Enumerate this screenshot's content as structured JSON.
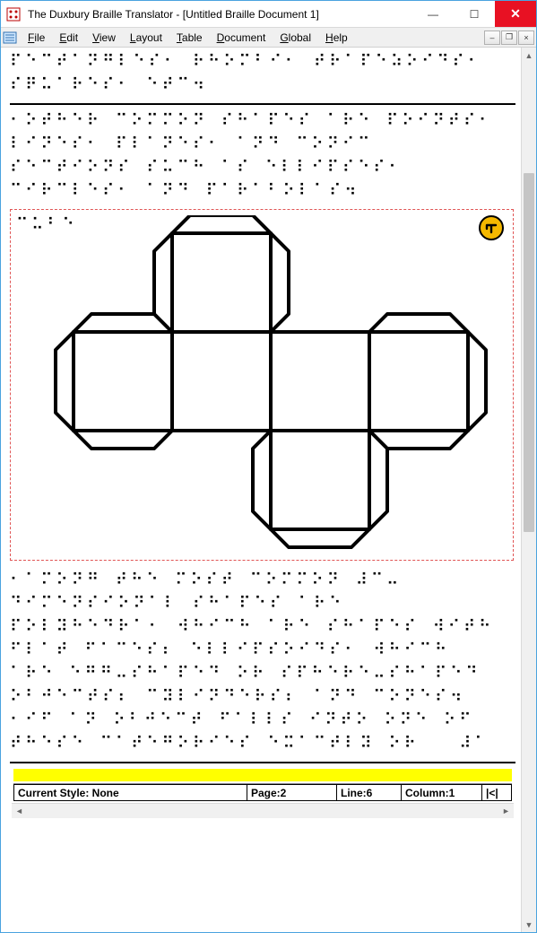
{
  "titlebar": {
    "title": "The Duxbury Braille Translator - [Untitled Braille Document 1]"
  },
  "menubar": {
    "items": [
      {
        "label": "File",
        "underline": "F"
      },
      {
        "label": "Edit",
        "underline": "E"
      },
      {
        "label": "View",
        "underline": "V"
      },
      {
        "label": "Layout",
        "underline": "L"
      },
      {
        "label": "Table",
        "underline": "T"
      },
      {
        "label": "Document",
        "underline": "D"
      },
      {
        "label": "Global",
        "underline": "G"
      },
      {
        "label": "Help",
        "underline": "H"
      }
    ]
  },
  "doc": {
    "braille1": "⠏⠑⠉⠞⠁⠝⠛⠇⠑⠎⠂ ⠗⠓⠕⠍⠃⠊⠂ ⠞⠗⠁⠏⠑⠵⠕⠊⠙⠎⠂\n⠎⠟⠥⠁⠗⠑⠎⠂ ⠑⠞⠉⠲",
    "braille2": "⠂⠕⠞⠓⠑⠗ ⠉⠕⠍⠍⠕⠝ ⠎⠓⠁⠏⠑⠎ ⠁⠗⠑ ⠏⠕⠊⠝⠞⠎⠂\n⠇⠊⠝⠑⠎⠂ ⠏⠇⠁⠝⠑⠎⠂ ⠁⠝⠙ ⠉⠕⠝⠊⠉\n⠎⠑⠉⠞⠊⠕⠝⠎ ⠎⠥⠉⠓ ⠁⠎ ⠑⠇⠇⠊⠏⠎⠑⠎⠂\n⠉⠊⠗⠉⠇⠑⠎⠂ ⠁⠝⠙ ⠏⠁⠗⠁⠃⠕⠇⠁⠎⠲",
    "embed_label": "⠉⠥⠃⠑",
    "braille3": "⠂⠁⠍⠕⠝⠛ ⠞⠓⠑ ⠍⠕⠎⠞ ⠉⠕⠍⠍⠕⠝ ⠼⠉⠤\n⠙⠊⠍⠑⠝⠎⠊⠕⠝⠁⠇ ⠎⠓⠁⠏⠑⠎ ⠁⠗⠑\n⠏⠕⠇⠽⠓⠑⠙⠗⠁⠂ ⠺⠓⠊⠉⠓ ⠁⠗⠑ ⠎⠓⠁⠏⠑⠎ ⠺⠊⠞⠓\n⠋⠇⠁⠞ ⠋⠁⠉⠑⠎⠆ ⠑⠇⠇⠊⠏⠎⠕⠊⠙⠎⠂ ⠺⠓⠊⠉⠓\n⠁⠗⠑ ⠑⠛⠛⠤⠎⠓⠁⠏⠑⠙ ⠕⠗ ⠎⠏⠓⠑⠗⠑⠤⠎⠓⠁⠏⠑⠙\n⠕⠃⠚⠑⠉⠞⠎⠆ ⠉⠽⠇⠊⠝⠙⠑⠗⠎⠆ ⠁⠝⠙ ⠉⠕⠝⠑⠎⠲\n⠂⠊⠋ ⠁⠝ ⠕⠃⠚⠑⠉⠞ ⠋⠁⠇⠇⠎ ⠊⠝⠞⠕ ⠕⠝⠑ ⠕⠋\n⠞⠓⠑⠎⠑ ⠉⠁⠞⠑⠛⠕⠗⠊⠑⠎ ⠑⠭⠁⠉⠞⠇⠽ ⠕⠗   ⠼⠁"
  },
  "status": {
    "style": "Current Style: None",
    "page": "Page:2",
    "line": "Line:6",
    "column": "Column:1",
    "end": "|<|"
  }
}
